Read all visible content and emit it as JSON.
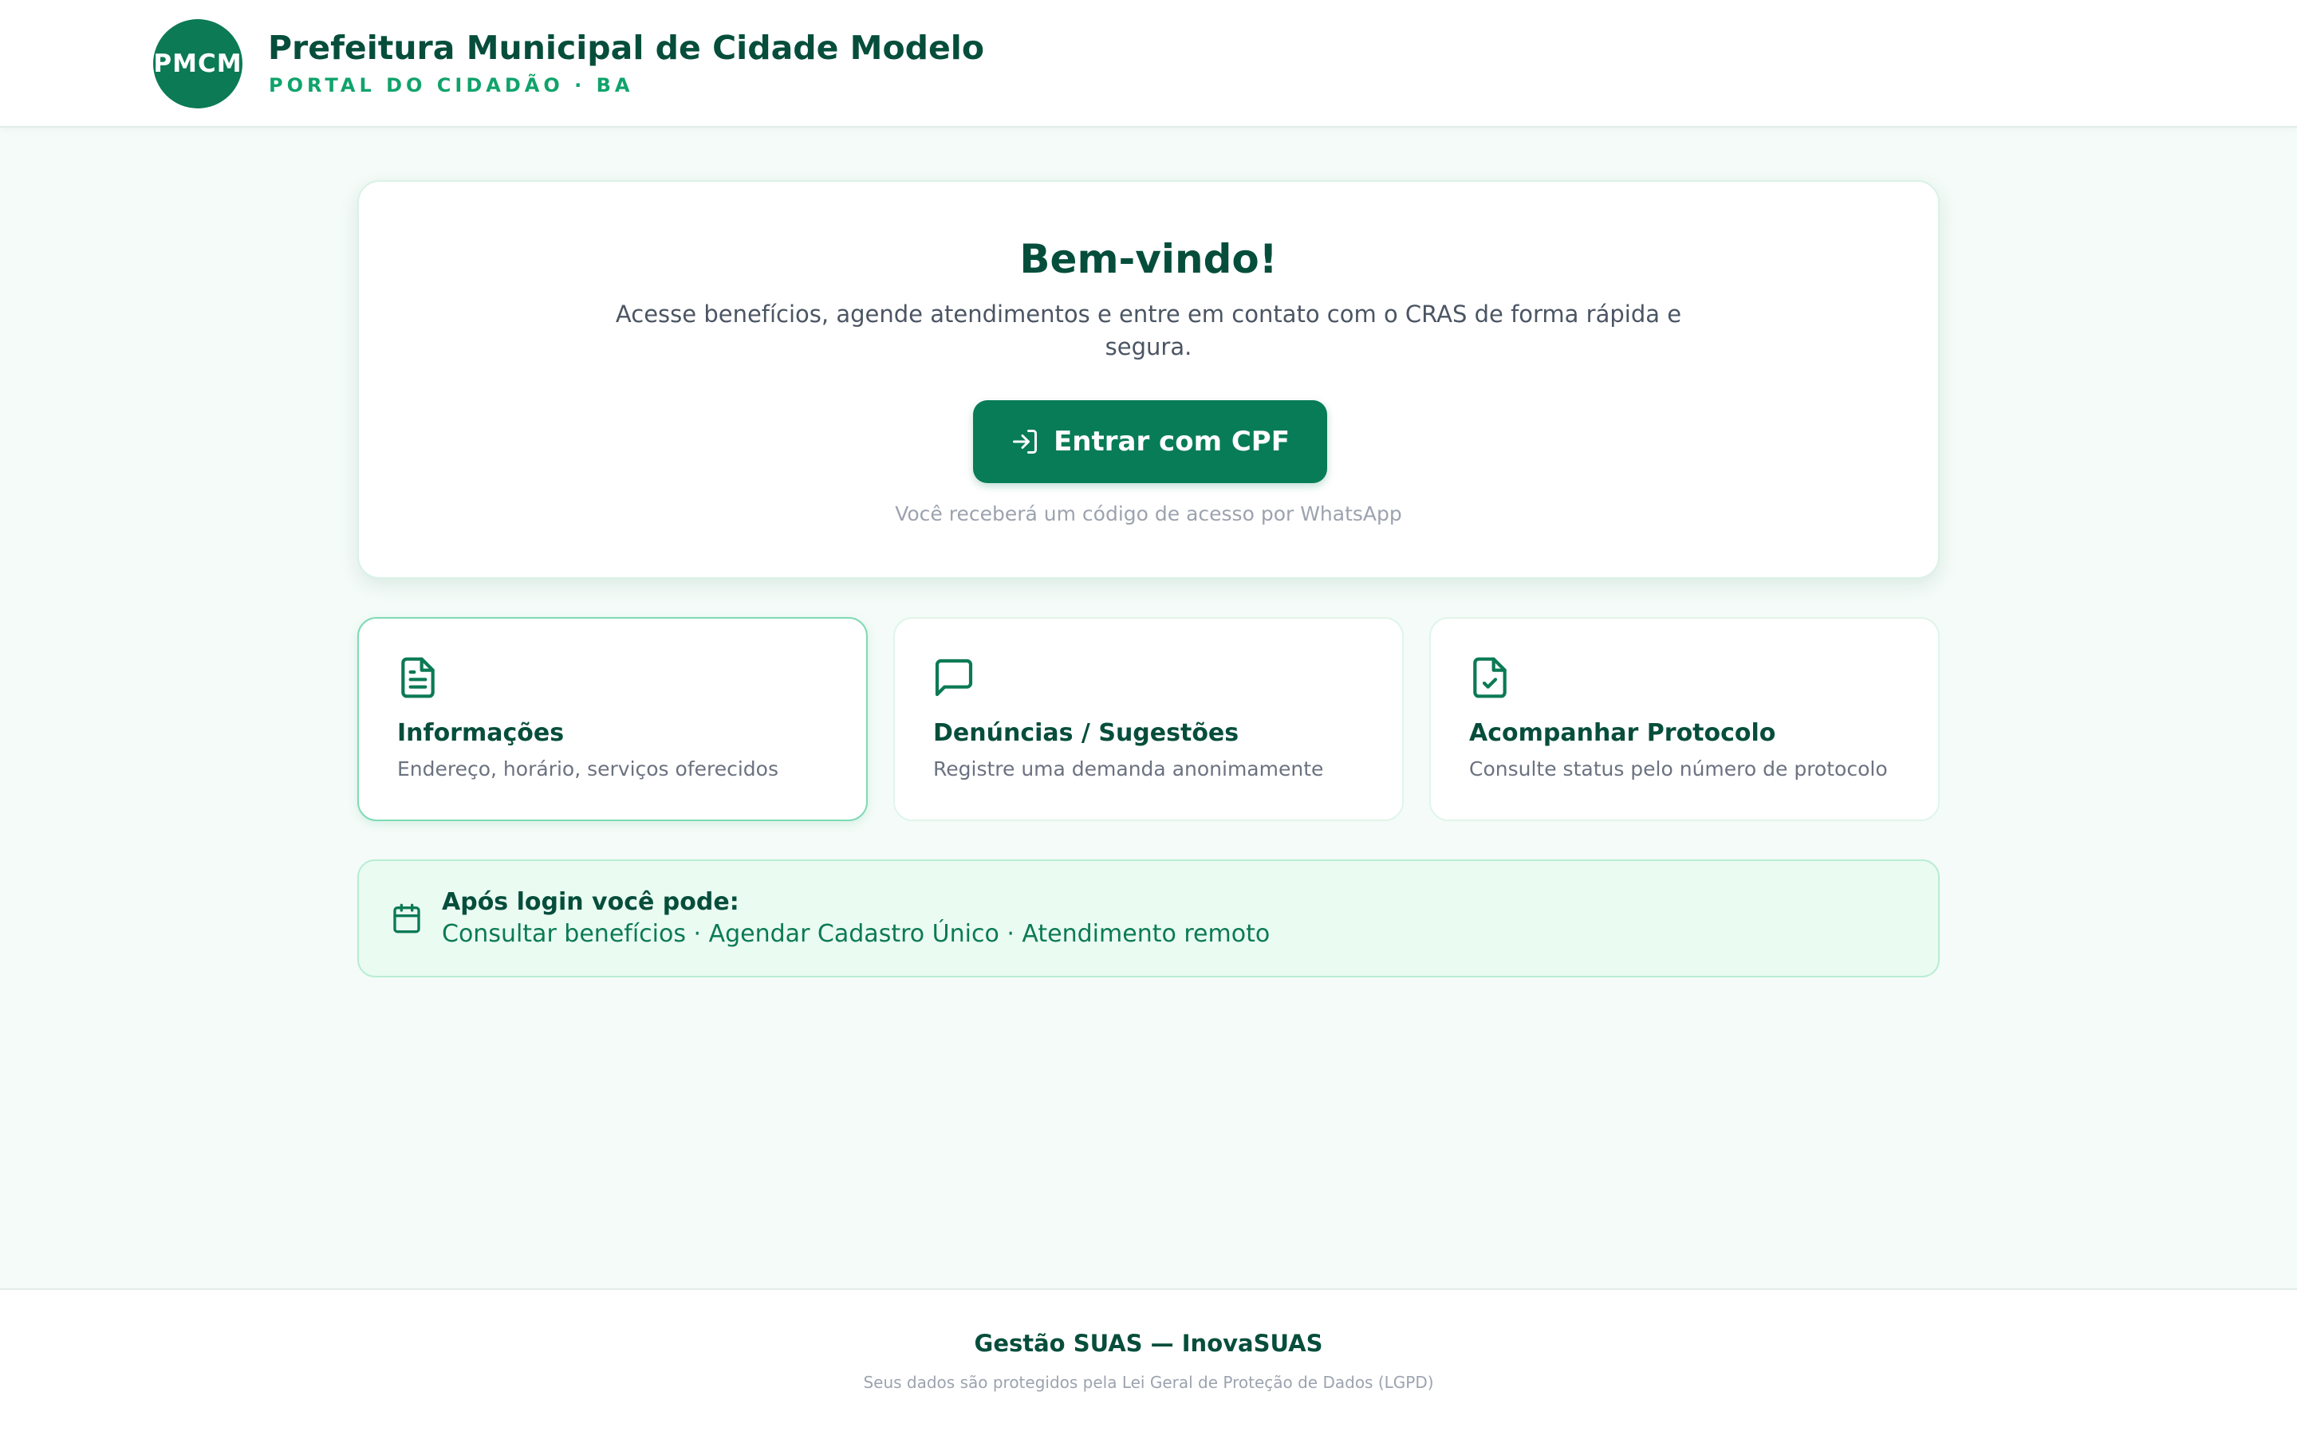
{
  "header": {
    "logo_text": "PMCM",
    "title": "Prefeitura Municipal de Cidade Modelo",
    "subtitle": "PORTAL DO CIDADÃO · BA"
  },
  "welcome": {
    "title": "Bem-vindo!",
    "description": "Acesse benefícios, agende atendimentos e entre em contato com o CRAS de forma rápida e segura.",
    "cta_label": "Entrar com CPF",
    "cta_icon": "log-in-icon",
    "hint": "Você receberá um código de acesso por WhatsApp"
  },
  "cards": [
    {
      "icon": "file-text-icon",
      "title": "Informações",
      "description": "Endereço, horário, serviços oferecidos",
      "active": true
    },
    {
      "icon": "message-square-icon",
      "title": "Denúncias / Sugestões",
      "description": "Registre uma demanda anonimamente",
      "active": false
    },
    {
      "icon": "file-check-icon",
      "title": "Acompanhar Protocolo",
      "description": "Consulte status pelo número de protocolo",
      "active": false
    }
  ],
  "banner": {
    "icon": "calendar-icon",
    "title": "Após login você pode:",
    "text": "Consultar benefícios · Agendar Cadastro Único · Atendimento remoto"
  },
  "footer": {
    "title": "Gestão SUAS — InovaSUAS",
    "note": "Seus dados são protegidos pela Lei Geral de Proteção de Dados (LGPD)"
  },
  "colors": {
    "brand": "#0b7a55",
    "brand_dark": "#064e3b",
    "accent": "#10a36c",
    "page_bg": "#f4fbf8",
    "banner_bg": "#eafbf2"
  }
}
